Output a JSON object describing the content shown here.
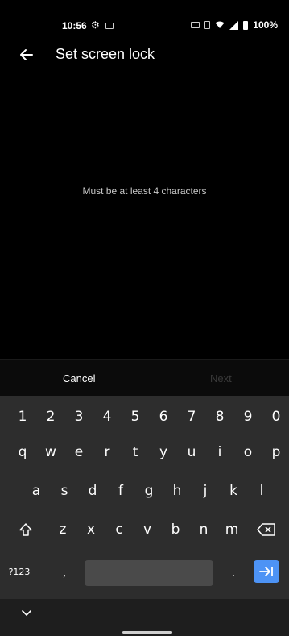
{
  "status_bar": {
    "time": "10:56",
    "battery": "100%",
    "icons": [
      "gear-icon",
      "image-icon",
      "keyboard-icon",
      "vibrate-icon",
      "wifi-icon",
      "signal-icon",
      "battery-icon"
    ]
  },
  "header": {
    "title": "Set screen lock"
  },
  "main": {
    "hint": "Must be at least 4 characters",
    "password_value": ""
  },
  "actions": {
    "cancel": "Cancel",
    "next": "Next"
  },
  "keyboard": {
    "number_row": [
      "1",
      "2",
      "3",
      "4",
      "5",
      "6",
      "7",
      "8",
      "9",
      "0"
    ],
    "row1": [
      "q",
      "w",
      "e",
      "r",
      "t",
      "y",
      "u",
      "i",
      "o",
      "p"
    ],
    "row2": [
      "a",
      "s",
      "d",
      "f",
      "g",
      "h",
      "j",
      "k",
      "l"
    ],
    "row3": [
      "z",
      "x",
      "c",
      "v",
      "b",
      "n",
      "m"
    ],
    "symbols_label": "?123",
    "comma": ",",
    "period": ".",
    "accent_color": "#4d93f5"
  }
}
